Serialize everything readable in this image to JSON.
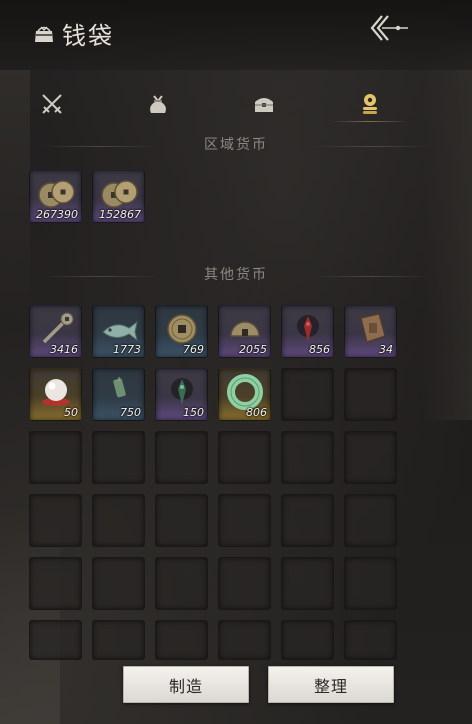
{
  "header": {
    "title": "钱袋"
  },
  "tabs": [
    {
      "icon": "crossed-swords-icon",
      "active": false
    },
    {
      "icon": "money-pouch-icon",
      "active": false
    },
    {
      "icon": "treasure-chest-icon",
      "active": false
    },
    {
      "icon": "coin-stack-icon",
      "active": true
    }
  ],
  "sections": {
    "regional": {
      "title": "区域货币",
      "items": [
        {
          "icon": "copper-coins-icon",
          "quantity": "267390",
          "rarity": "purple"
        },
        {
          "icon": "copper-coins-icon",
          "quantity": "152867",
          "rarity": "purple"
        }
      ]
    },
    "other": {
      "title": "其他货币",
      "items": [
        {
          "icon": "ancient-key-coin-icon",
          "quantity": "3416",
          "rarity": "purple"
        },
        {
          "icon": "jade-fish-icon",
          "quantity": "1773",
          "rarity": "blue"
        },
        {
          "icon": "square-hole-coin-icon",
          "quantity": "769",
          "rarity": "blue"
        },
        {
          "icon": "half-coin-icon",
          "quantity": "2055",
          "rarity": "purple"
        },
        {
          "icon": "red-talisman-icon",
          "quantity": "856",
          "rarity": "purple"
        },
        {
          "icon": "bronze-token-icon",
          "quantity": "34",
          "rarity": "purple"
        },
        {
          "icon": "pearl-icon",
          "quantity": "50",
          "rarity": "gold"
        },
        {
          "icon": "jade-pendant-icon",
          "quantity": "750",
          "rarity": "blue"
        },
        {
          "icon": "green-talisman-icon",
          "quantity": "150",
          "rarity": "purple"
        },
        {
          "icon": "jade-ring-icon",
          "quantity": "806",
          "rarity": "gold"
        }
      ],
      "total_slots": 36
    }
  },
  "buttons": {
    "craft": "制造",
    "sort": "整理"
  }
}
